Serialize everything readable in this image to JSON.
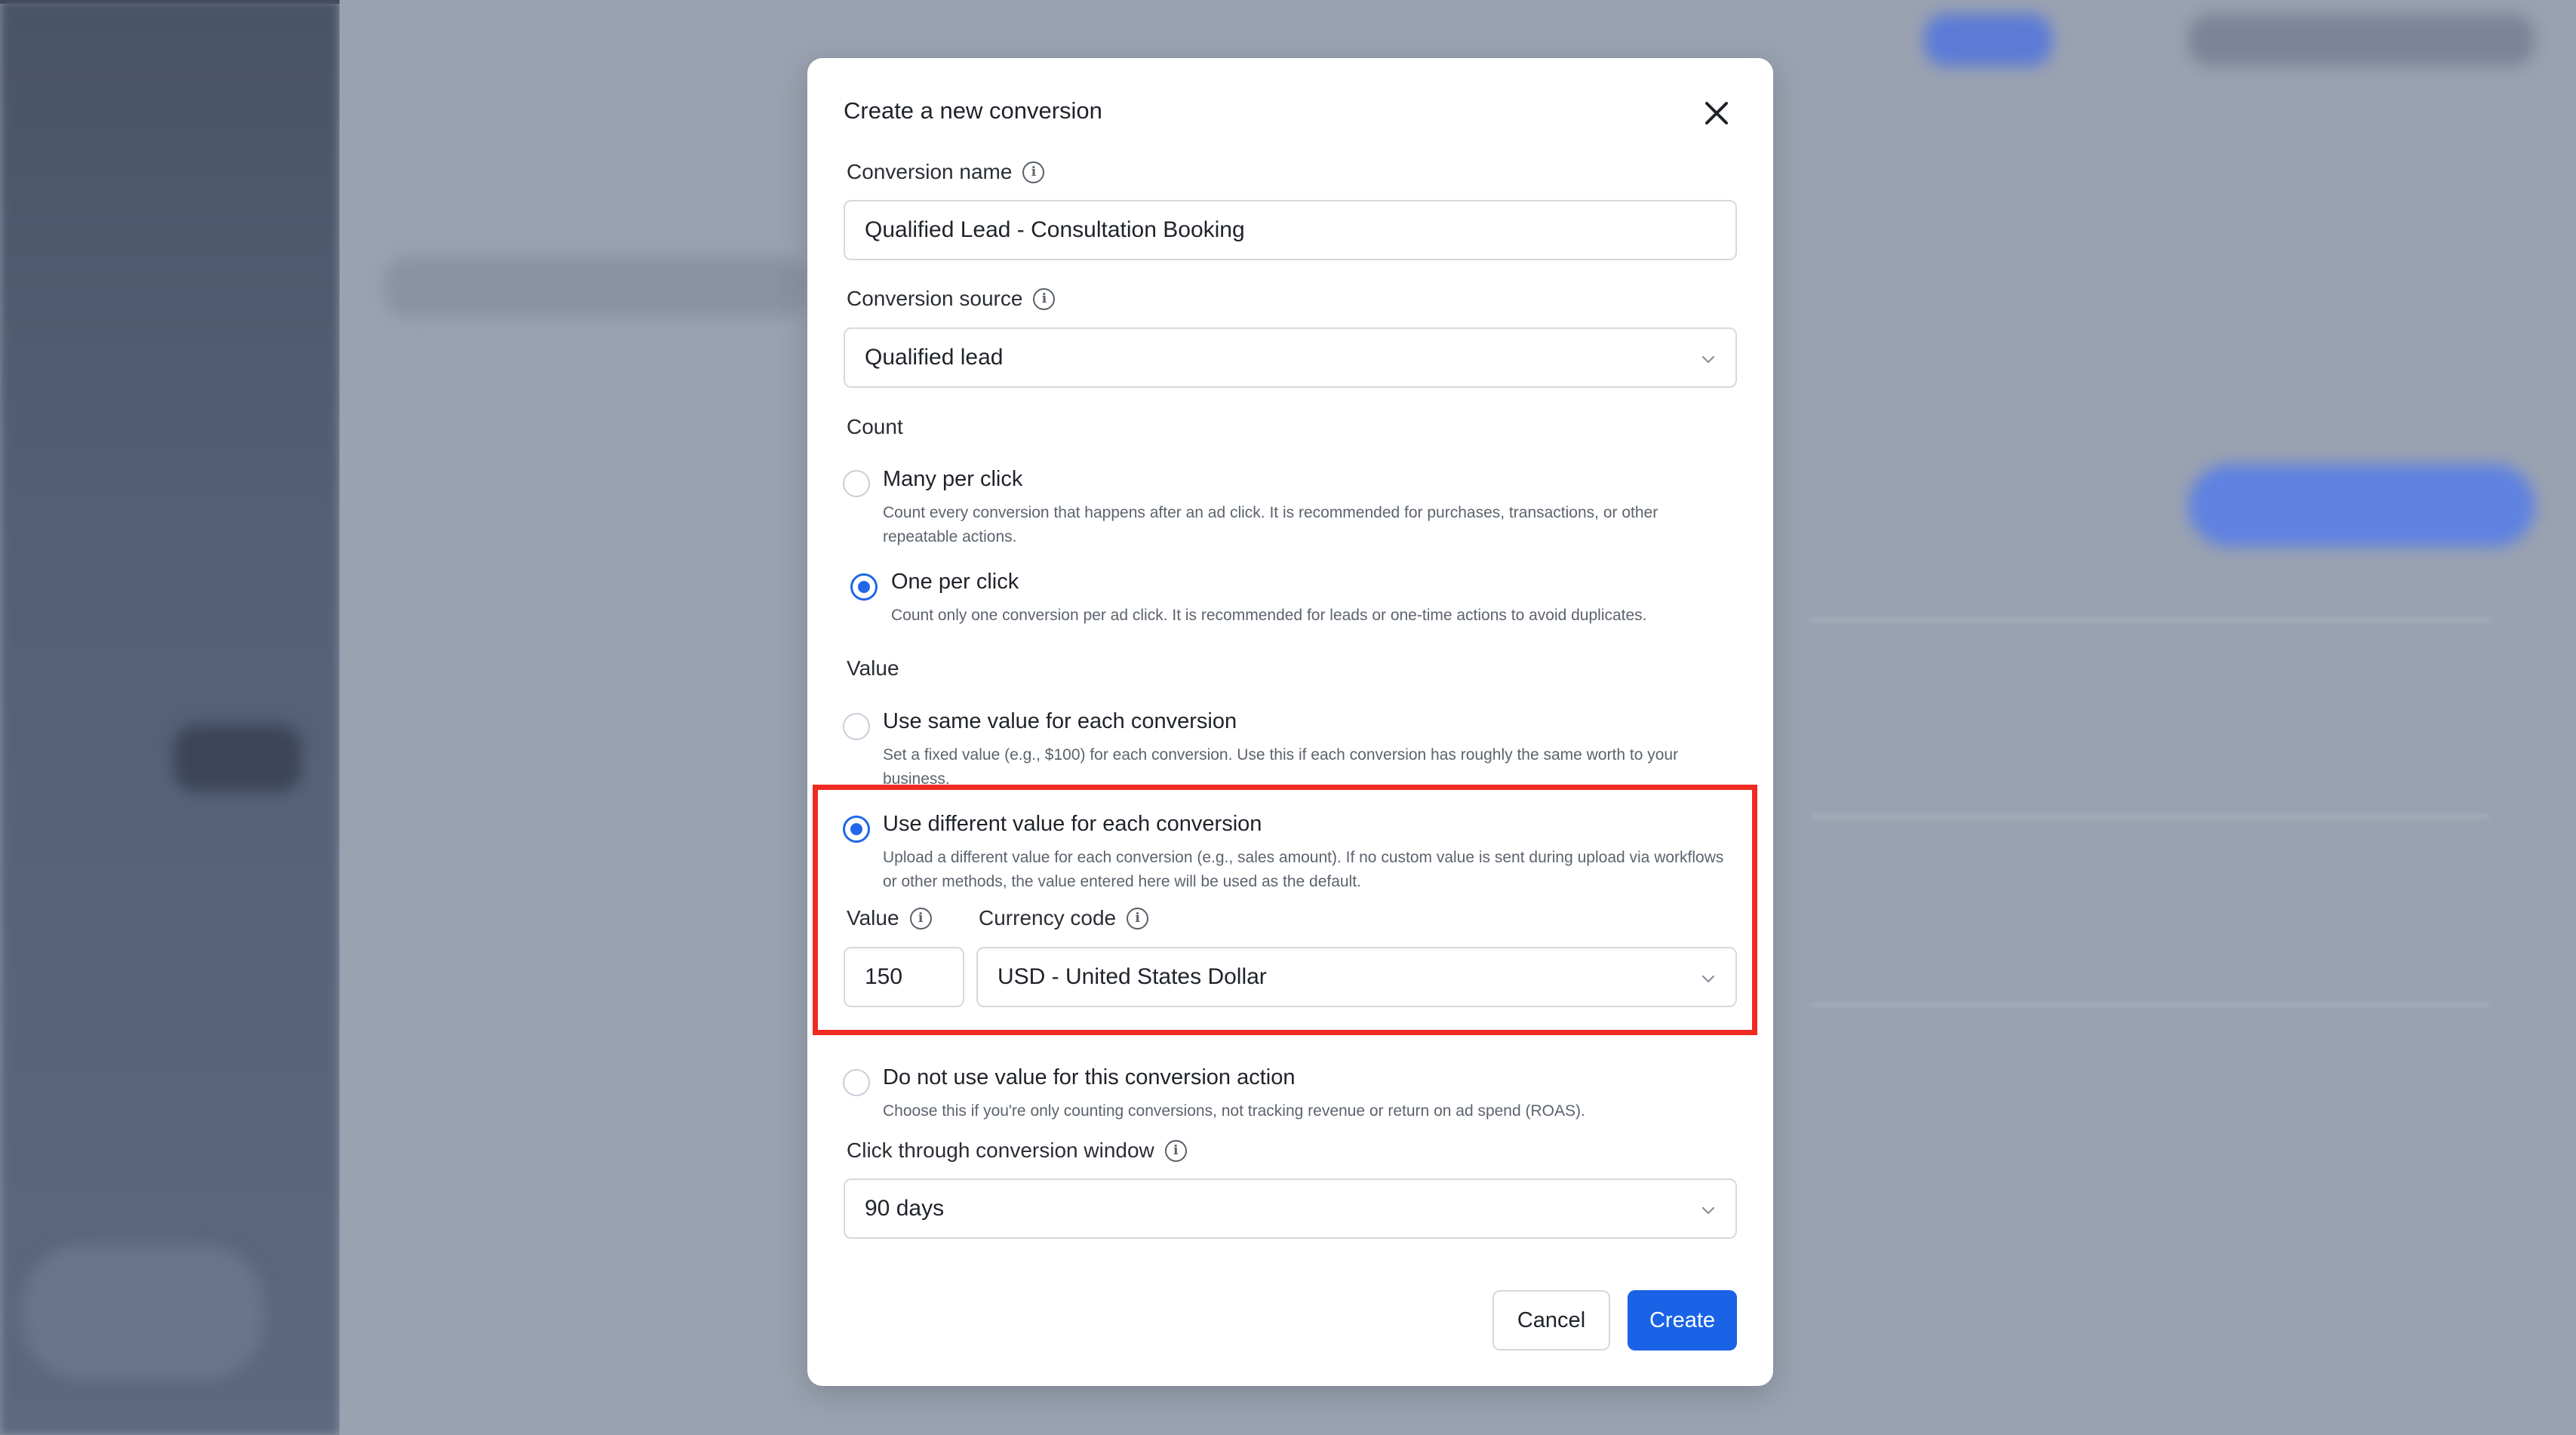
{
  "modal": {
    "title": "Create a new conversion",
    "conversion_name": {
      "label": "Conversion name",
      "value": "Qualified Lead - Consultation Booking"
    },
    "conversion_source": {
      "label": "Conversion source",
      "value": "Qualified lead"
    },
    "count": {
      "label": "Count",
      "options": [
        {
          "title": "Many per click",
          "desc": "Count every conversion that happens after an ad click. It is recommended for purchases, transactions, or other repeatable actions.",
          "checked": false
        },
        {
          "title": "One per click",
          "desc": "Count only one conversion per ad click. It is recommended for leads or one-time actions to avoid duplicates.",
          "checked": true
        }
      ]
    },
    "value": {
      "label": "Value",
      "options": [
        {
          "title": "Use same value for each conversion",
          "desc": "Set a fixed value (e.g., $100) for each conversion. Use this if each conversion has roughly the same worth to your business.",
          "checked": false
        },
        {
          "title": "Use different value for each conversion",
          "desc": "Upload a different value for each conversion (e.g., sales amount). If no custom value is sent during upload via workflows or other methods, the value entered here will be used as the default.",
          "checked": true
        },
        {
          "title": "Do not use value for this conversion action",
          "desc": "Choose this if you're only counting conversions, not tracking revenue or return on ad spend (ROAS).",
          "checked": false
        }
      ],
      "amount_label": "Value",
      "amount": "150",
      "currency_label": "Currency code",
      "currency": "USD - United States Dollar"
    },
    "window": {
      "label": "Click through conversion window",
      "value": "90 days"
    },
    "buttons": {
      "cancel": "Cancel",
      "create": "Create"
    }
  },
  "colors": {
    "accent": "#1a63e6",
    "highlight": "#ef2b22"
  }
}
